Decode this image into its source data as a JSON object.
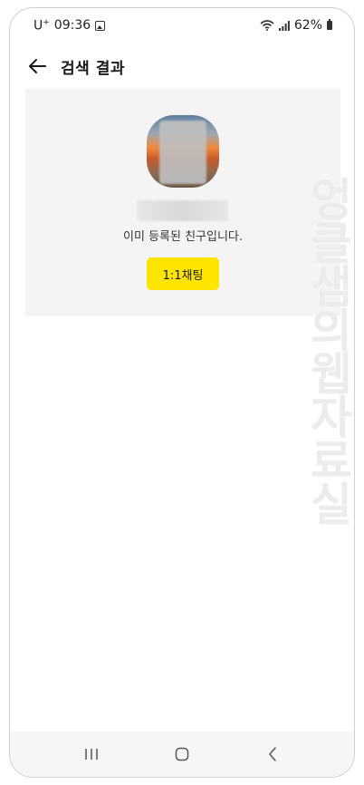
{
  "status_bar": {
    "carrier": "U",
    "carrier_sup": "+",
    "time": "09:36",
    "battery": "62%"
  },
  "header": {
    "title": "검색 결과",
    "back_icon": "arrow-left-icon"
  },
  "result": {
    "message": "이미 등록된 친구입니다.",
    "chat_button_label": "1:1채팅",
    "button_color": "#fee500"
  },
  "watermark": "엉클샘의웹자료실",
  "nav_bar": {
    "icons": [
      "recent-apps-icon",
      "home-icon",
      "back-chevron-icon"
    ]
  }
}
